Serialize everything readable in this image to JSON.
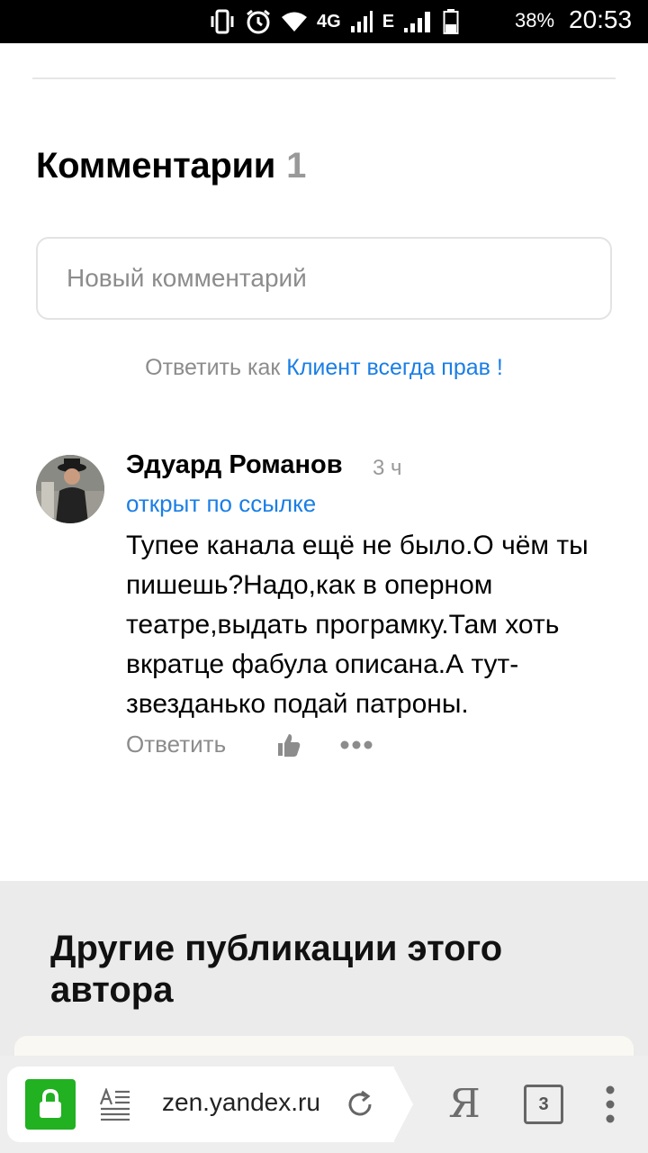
{
  "status_bar": {
    "network_4g": "4G",
    "network_e": "E",
    "battery_percent": "38%",
    "time": "20:53",
    "icons": [
      "vibrate-icon",
      "alarm-icon",
      "wifi-icon",
      "signal-icon",
      "signal-icon",
      "battery-icon"
    ]
  },
  "comments": {
    "title": "Комментарии",
    "count": "1",
    "new_comment_placeholder": "Новый комментарий",
    "reply_as_prefix": "Ответить как",
    "reply_as_name": "Клиент всегда прав !"
  },
  "comment": {
    "author": "Эдуард Романов",
    "time": "3 ч",
    "via_link": "открыт по ссылке",
    "text": "Тупее канала ещё не было.О чём ты пишешь?Надо,как в оперном театре,выдать програмку.Там хоть вкратце фабула описана.А тут-звезданько подай патроны.",
    "reply_label": "Ответить",
    "actions": [
      "like-icon",
      "more-icon"
    ]
  },
  "other": {
    "title": "Другие публикации этого автора"
  },
  "browser": {
    "url": "zen.yandex.ru",
    "tabs_count": "3",
    "ya_label": "Я"
  },
  "colors": {
    "link": "#1a7ee6",
    "secure": "#21b121",
    "muted": "#8c8c8c",
    "section_bg": "#ebebeb"
  }
}
